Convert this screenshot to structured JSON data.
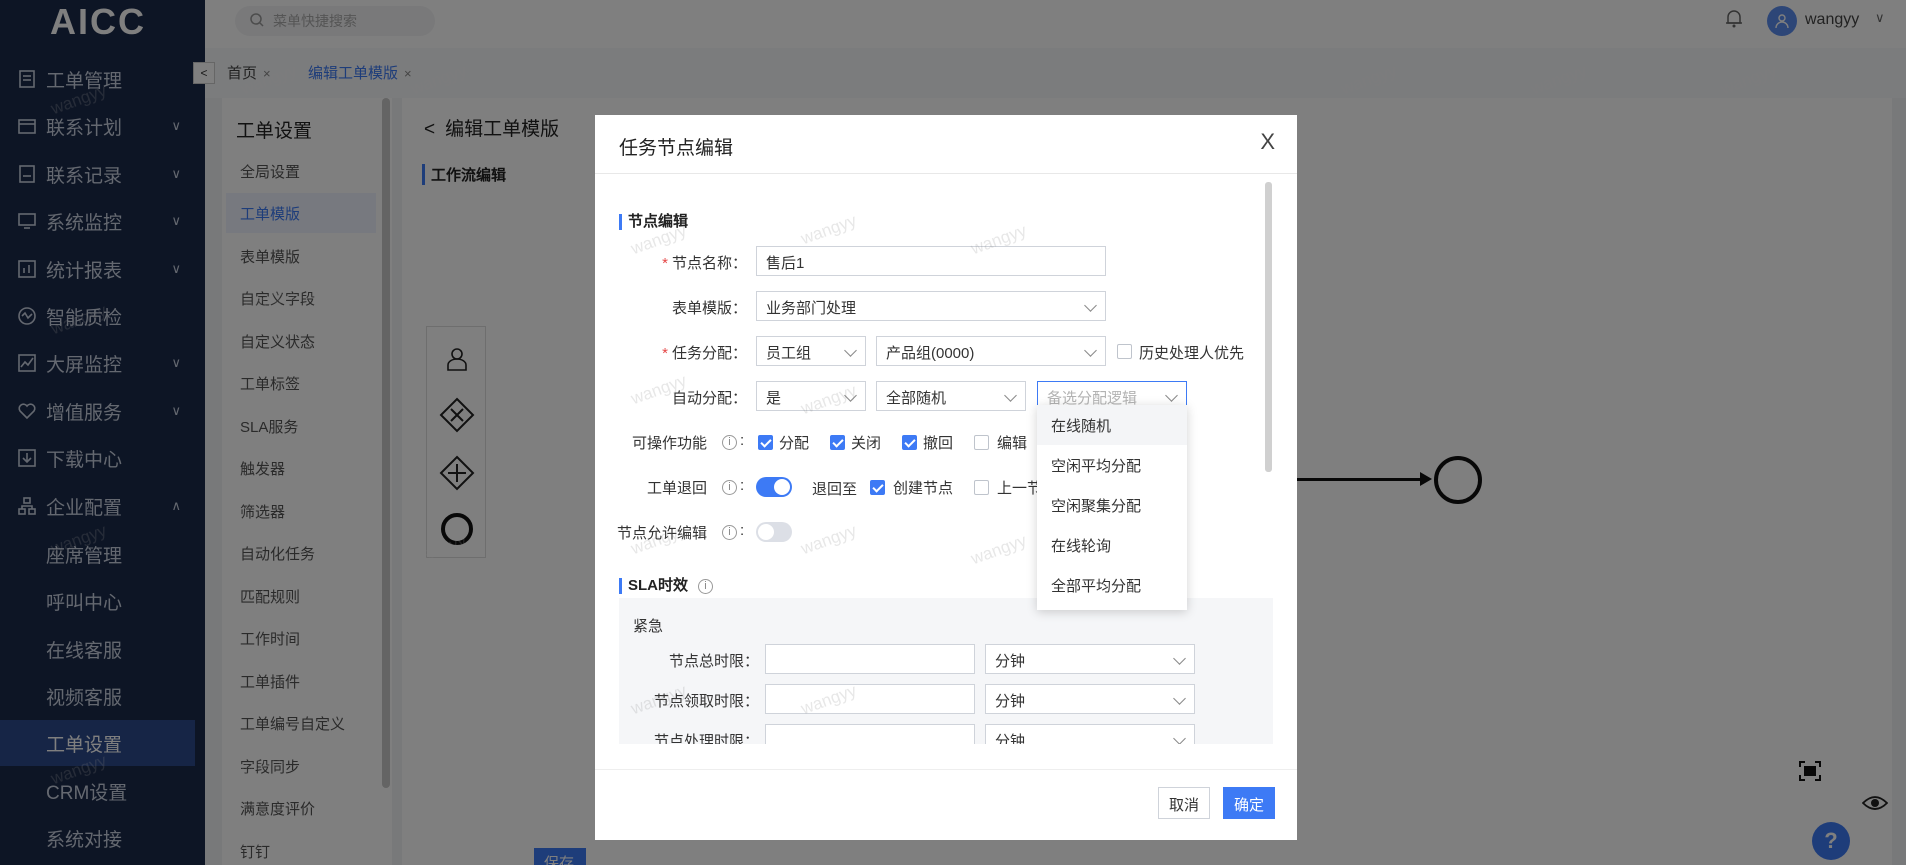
{
  "sidebar": {
    "logo": "AICC",
    "items": [
      {
        "label": "工单管理",
        "icon": "ticket-icon",
        "arrow": ""
      },
      {
        "label": "联系计划",
        "icon": "calendar-icon",
        "arrow": "∨"
      },
      {
        "label": "联系记录",
        "icon": "record-icon",
        "arrow": "∨"
      },
      {
        "label": "系统监控",
        "icon": "monitor-icon",
        "arrow": "∨"
      },
      {
        "label": "统计报表",
        "icon": "report-icon",
        "arrow": "∨"
      },
      {
        "label": "智能质检",
        "icon": "quality-icon",
        "arrow": ""
      },
      {
        "label": "大屏监控",
        "icon": "chart-icon",
        "arrow": "∨"
      },
      {
        "label": "增值服务",
        "icon": "heart-icon",
        "arrow": "∨"
      },
      {
        "label": "下载中心",
        "icon": "download-icon",
        "arrow": ""
      },
      {
        "label": "企业配置",
        "icon": "org-icon",
        "arrow": "∧"
      }
    ],
    "sub_items": [
      {
        "label": "座席管理"
      },
      {
        "label": "呼叫中心"
      },
      {
        "label": "在线客服"
      },
      {
        "label": "视频客服"
      },
      {
        "label": "工单设置"
      },
      {
        "label": "CRM设置"
      },
      {
        "label": "系统对接"
      }
    ]
  },
  "topbar": {
    "search_placeholder": "菜单快捷搜索",
    "username": "wangyy"
  },
  "tabs": [
    {
      "label": "首页"
    },
    {
      "label": "编辑工单模版"
    }
  ],
  "settings_nav": {
    "heading": "工单设置",
    "items": [
      "全局设置",
      "工单模版",
      "表单模版",
      "自定义字段",
      "自定义状态",
      "工单标签",
      "SLA服务",
      "触发器",
      "筛选器",
      "自动化任务",
      "匹配规则",
      "工作时间",
      "工单插件",
      "工单编号自定义",
      "字段同步",
      "满意度评价",
      "钉钉"
    ],
    "active_index": 1
  },
  "main": {
    "back_title": "编辑工单模版",
    "section_title": "工作流编辑",
    "save_label": "保存"
  },
  "dialog": {
    "title": "任务节点编辑",
    "close": "X",
    "section_node": "节点编辑",
    "node_name": {
      "label": "节点名称：",
      "value": "售后1",
      "required": true
    },
    "form_template": {
      "label": "表单模版：",
      "value": "业务部门处理"
    },
    "task_assign": {
      "label": "任务分配：",
      "required": true,
      "type_value": "员工组",
      "group_value": "产品组(0000)",
      "history_label": "历史处理人优先"
    },
    "auto_assign": {
      "label": "自动分配：",
      "enabled_value": "是",
      "scope_value": "全部随机",
      "logic_placeholder": "备选分配逻辑"
    },
    "operations": {
      "label": "可操作功能",
      "options": [
        {
          "label": "分配",
          "checked": true
        },
        {
          "label": "关闭",
          "checked": true
        },
        {
          "label": "撤回",
          "checked": true
        },
        {
          "label": "编辑",
          "checked": false
        }
      ]
    },
    "ticket_return": {
      "label": "工单退回",
      "enabled": true,
      "return_to_label": "退回至",
      "create_node_label": "创建节点",
      "create_node_checked": true,
      "prev_node_label": "上一节",
      "prev_node_checked": false
    },
    "node_edit": {
      "label": "节点允许编辑",
      "enabled": false
    },
    "section_sla": "SLA时效",
    "sla": {
      "level": "紧急",
      "rows": [
        {
          "label": "节点总时限：",
          "value": "",
          "unit": "分钟"
        },
        {
          "label": "节点领取时限：",
          "value": "",
          "unit": "分钟"
        },
        {
          "label": "节点处理时限：",
          "value": "",
          "unit": "分钟"
        }
      ]
    },
    "cancel_label": "取消",
    "confirm_label": "确定"
  },
  "dropdown": {
    "options": [
      "在线随机",
      "空闲平均分配",
      "空闲聚集分配",
      "在线轮询",
      "全部平均分配"
    ],
    "highlighted_index": 0
  },
  "watermark_text": "wangyy",
  "colors": {
    "accent": "#3d7af5",
    "sidebar_bg": "#1b2a4a",
    "sidebar_active": "#2c4a8c",
    "required": "#e54545"
  }
}
